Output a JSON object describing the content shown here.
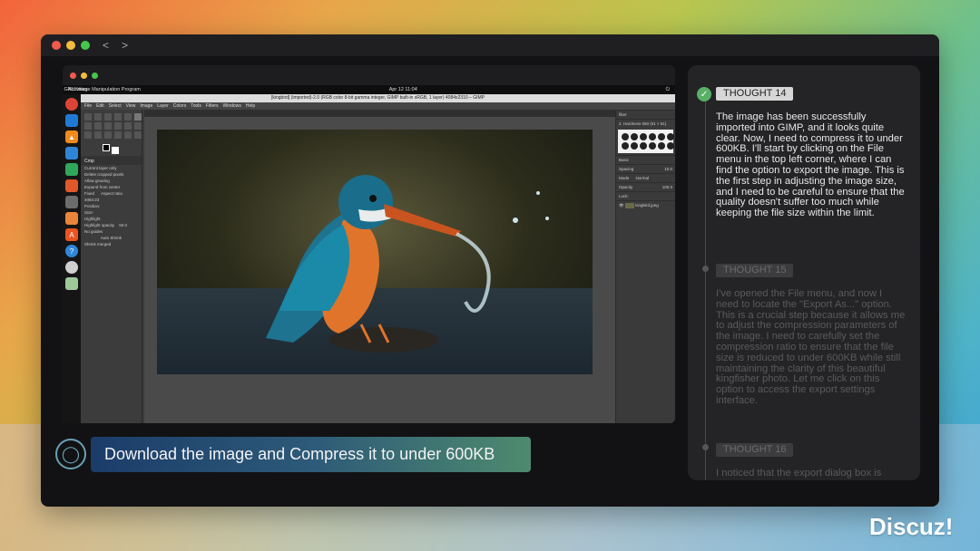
{
  "desktop": {
    "top_left": "Activities",
    "app_name": "GNU Image Manipulation Program",
    "clock": "Apr 12  11:04"
  },
  "gimp": {
    "title": "[kingbird] (imported)-2.0 (RGB color 8-bit gamma integer, GIMP built-in sRGB, 1 layer) 4084x2310 – GIMP",
    "menu": [
      "File",
      "Edit",
      "Select",
      "View",
      "Image",
      "Layer",
      "Colors",
      "Tools",
      "Filters",
      "Windows",
      "Help"
    ],
    "tool_options": {
      "header": "Crop",
      "opt1": "Current layer only",
      "opt2": "Delete cropped pixels",
      "opt3": "Allow growing",
      "opt4": "Expand from center",
      "fixed": "Fixed",
      "aspect": "Aspect ratio",
      "ratio_value": "4084:23",
      "position_label": "Position:",
      "size_label": "Size:",
      "highlight": "Highlight",
      "highlight_opacity": "Highlight opacity",
      "highlight_value": "50.0",
      "guides": "No guides",
      "autoshrink": "Auto Shrink",
      "shrink_merged": "Shrink merged"
    },
    "brushes": {
      "filter": "filter",
      "brush_name": "2. Hardness 050 (51 × 51)",
      "basic": "Basic",
      "spacing_label": "Spacing",
      "spacing_value": "10.0"
    },
    "layers": {
      "mode_label": "Mode",
      "mode_value": "Normal",
      "opacity_label": "Opacity",
      "opacity_value": "100.0",
      "lock_label": "Lock:",
      "layer_name": "kingbird.jpeg"
    }
  },
  "task": {
    "text": "Download the image and  Compress it to under 600KB"
  },
  "thoughts": [
    {
      "label": "THOUGHT 14",
      "text": "The image has been successfully imported into GIMP, and it looks quite clear. Now, I need to compress it to under 600KB. I'll start by clicking on the File menu in the top left corner, where I can find the option to export the image. This is the first step in adjusting the image size, and I need to be careful to ensure that the quality doesn't suffer too much while keeping the file size within the limit."
    },
    {
      "label": "THOUGHT 15",
      "text": "I've opened the File menu, and now I need to locate the \"Export As...\" option. This is a crucial step because it allows me to adjust the compression parameters of the image. I need to carefully set the compression ratio to ensure that the file size is reduced to under 600KB while still maintaining the clarity of this beautiful kingfisher photo. Let me click on this option to access the export settings interface."
    },
    {
      "label": "THOUGHT 16",
      "text": "I noticed that the export dialog box is"
    }
  ],
  "brand": "Discuz!",
  "colors": {
    "accent_check": "#57b066",
    "task_bar_start": "#1b3c6a",
    "task_bar_end": "#4e8a6e"
  }
}
